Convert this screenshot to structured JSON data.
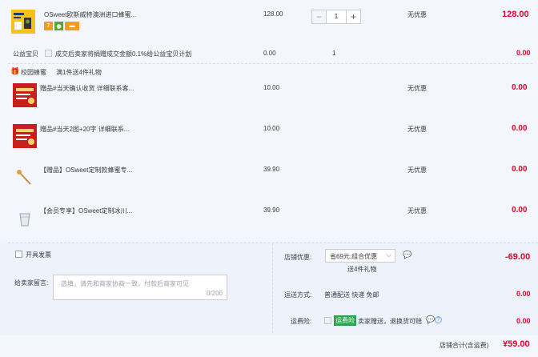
{
  "main_item": {
    "title": "OSweet欧斯威特澳洲进口蜂蜜...",
    "unit_price": "128.00",
    "quantity": "1",
    "promo": "无优惠",
    "subtotal": "128.00",
    "tags": [
      "7",
      "digital-icon",
      "card-icon"
    ]
  },
  "charity": {
    "label": "公益宝贝",
    "text": "成交后卖家将捐赠成交金额0.1%给公益宝贝计划",
    "price": "0.00",
    "quantity": "1",
    "subtotal": "0.00"
  },
  "gift_header": {
    "shop": "校园蜂蜜",
    "text": "满1件送4件礼物"
  },
  "gifts": [
    {
      "title": "赠品#当天确认收货 详细联系客...",
      "price": "10.00",
      "promo": "无优惠",
      "subtotal": "0.00"
    },
    {
      "title": "赠品#当天2图+20字 详细联系...",
      "price": "10.00",
      "promo": "无优惠",
      "subtotal": "0.00"
    },
    {
      "title": "【赠品】OSweet定制款蜂蜜专...",
      "price": "39.90",
      "promo": "无优惠",
      "subtotal": "0.00"
    },
    {
      "title": "【会员专享】OSweet定制冰川...",
      "price": "39.90",
      "promo": "无优惠",
      "subtotal": "0.00"
    }
  ],
  "invoice": {
    "label": "开具发票"
  },
  "message": {
    "label": "给卖家留言:",
    "placeholder": "选填，请先和商家协商一致，付款后商家可见",
    "counter": "0/200"
  },
  "discount": {
    "label": "店铺优惠:",
    "selected": "省69元:组合优惠",
    "note": "送4件礼物",
    "amount": "-69.00"
  },
  "shipping": {
    "label": "运送方式:",
    "method": "普通配送 快递 免邮",
    "amount": "0.00"
  },
  "insurance": {
    "label": "运费险:",
    "badge": "运费险",
    "text": "卖家赠送，退换货可赔",
    "amount": "0.00"
  },
  "total": {
    "label": "店铺合计(含运费)",
    "amount": "¥59.00"
  },
  "colors": {
    "price_red": "#e4002b",
    "panel_bg": "#eef2fb",
    "badge_green": "#2aa34a"
  }
}
